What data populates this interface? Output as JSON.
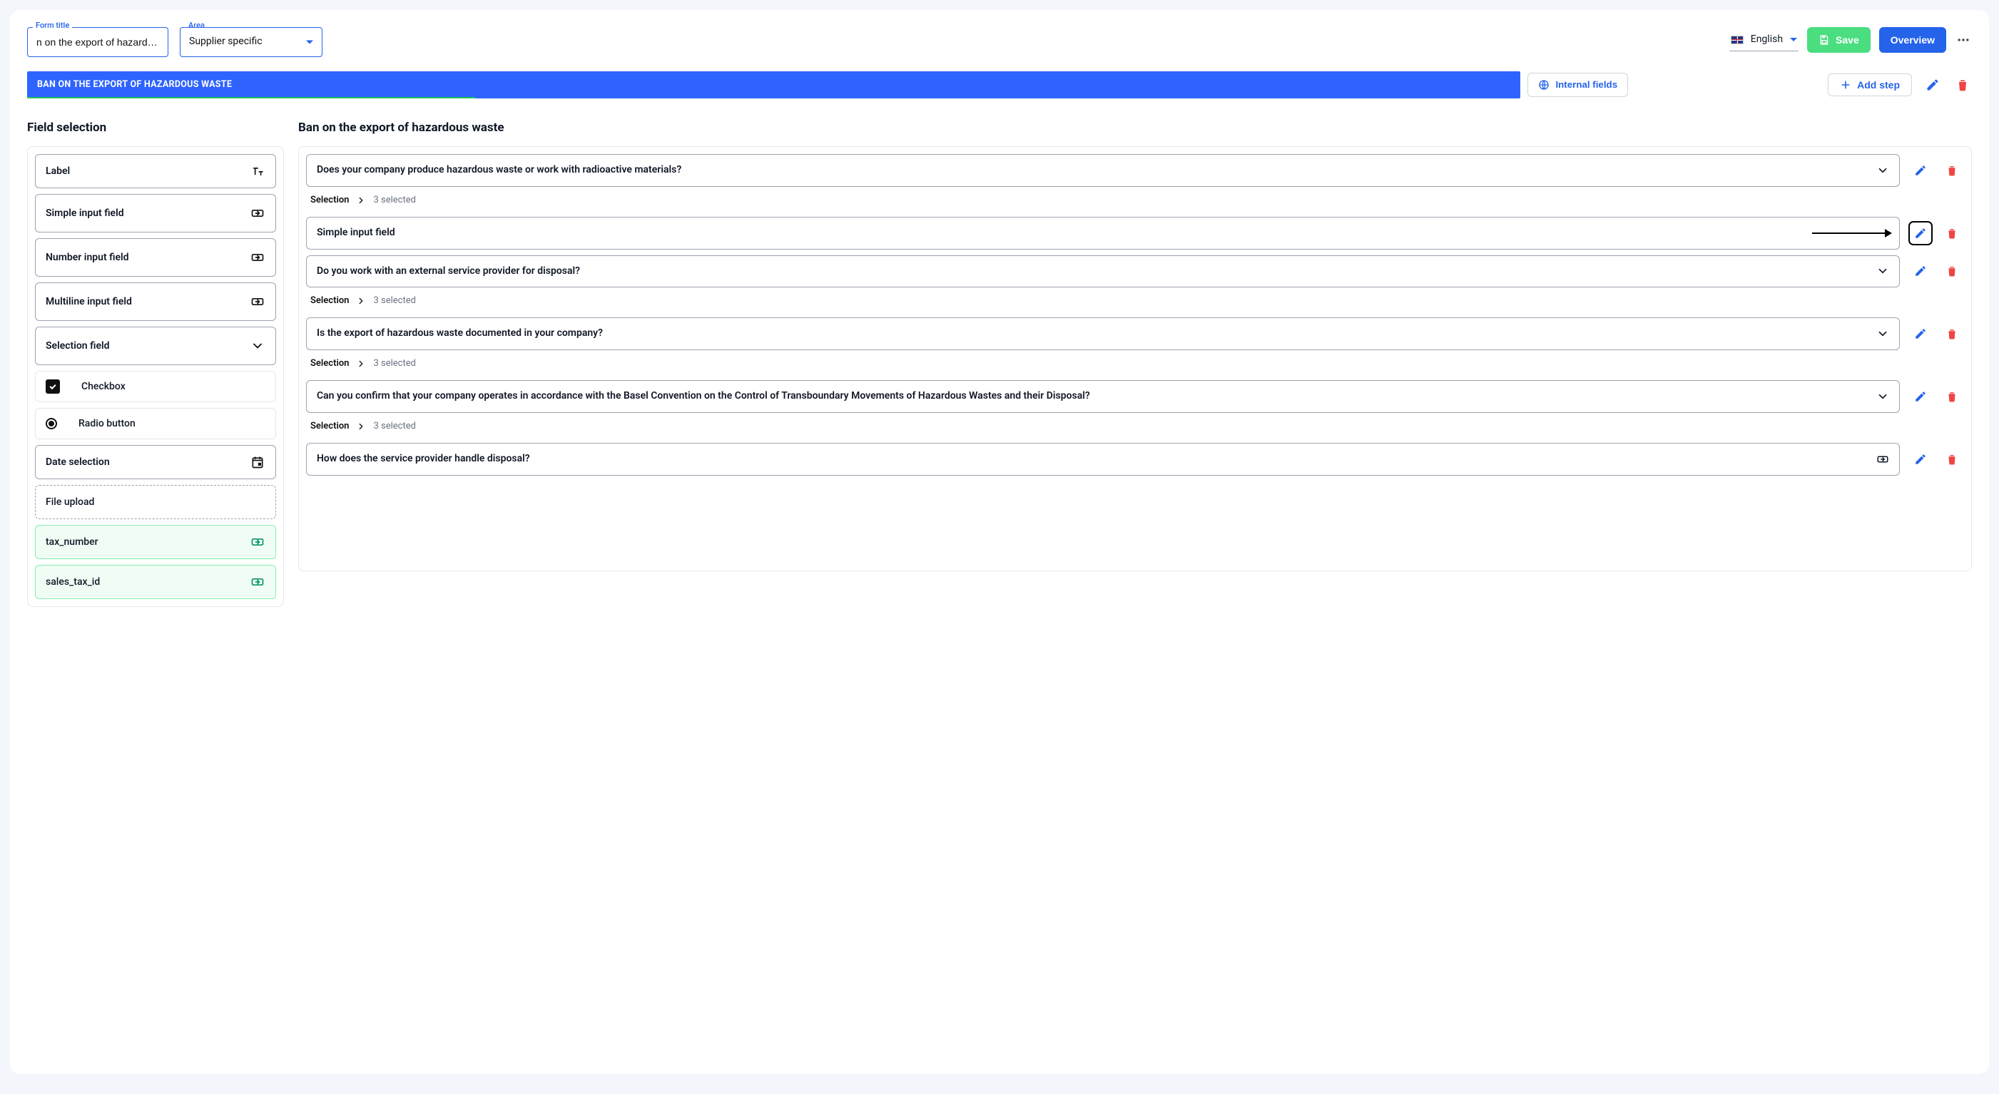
{
  "header": {
    "form_title_label": "Form title",
    "form_title_value": "n on the export of hazardous waste",
    "area_label": "Area",
    "area_value": "Supplier specific",
    "language": "English",
    "save_label": "Save",
    "overview_label": "Overview"
  },
  "step": {
    "active_tab": "BAN ON THE EXPORT OF HAZARDOUS WASTE",
    "internal_fields_label": "Internal fields",
    "add_step_label": "Add step"
  },
  "left": {
    "title": "Field selection",
    "options": {
      "label": "Label",
      "simple_input": "Simple input field",
      "number_input": "Number input field",
      "multiline_input": "Multiline input field",
      "selection_field": "Selection field",
      "checkbox": "Checkbox",
      "radio": "Radio button",
      "date_selection": "Date selection",
      "file_upload": "File upload",
      "tax_number": "tax_number",
      "sales_tax_id": "sales_tax_id"
    }
  },
  "right": {
    "title": "Ban on the export of hazardous waste",
    "selection_label": "Selection",
    "selected_suffix": "selected",
    "rows": [
      {
        "text": "Does your company produce hazardous waste or work with radioactive materials?",
        "kind": "selection",
        "count": 3,
        "expand": true
      },
      {
        "text": "Simple input field",
        "kind": "input",
        "highlight_edit": true
      },
      {
        "text": "Do you work with an external service provider for disposal?",
        "kind": "selection",
        "count": 3,
        "expand": true
      },
      {
        "text": "Is the export of hazardous waste documented in your company?",
        "kind": "selection",
        "count": 3,
        "expand": true
      },
      {
        "text": "Can you confirm that your company operates in accordance with the Basel Convention on the Control of Transboundary Movements of Hazardous Wastes and their Disposal?",
        "kind": "selection",
        "count": 3,
        "expand": true
      },
      {
        "text": "How does the service provider handle disposal?",
        "kind": "input"
      }
    ]
  }
}
